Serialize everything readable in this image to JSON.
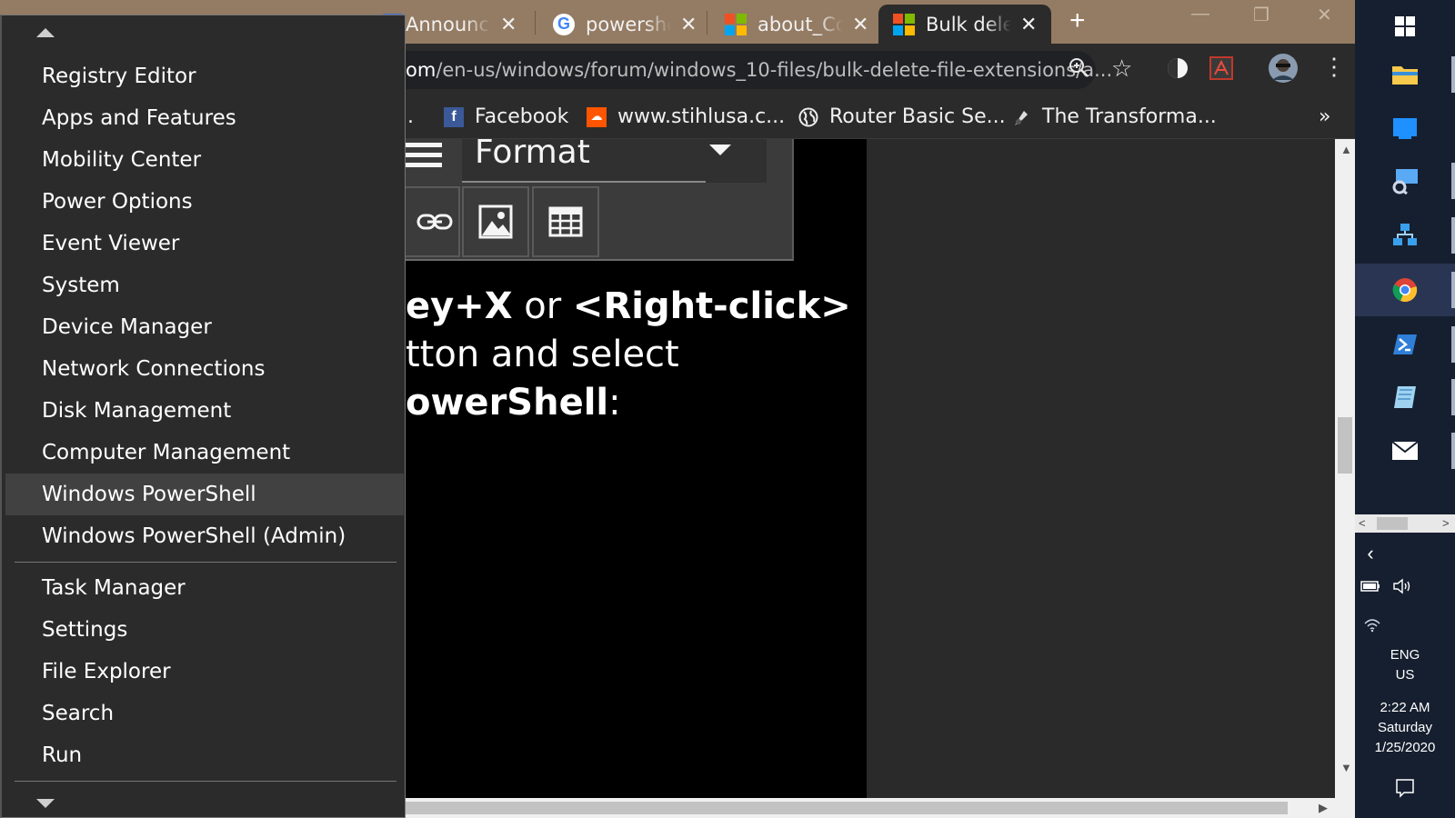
{
  "browser": {
    "tabs": [
      {
        "title": "Announc",
        "close": "✕",
        "icon": "announcement-icon"
      },
      {
        "title": "powershe",
        "close": "✕",
        "icon": "google-icon"
      },
      {
        "title": "about_Co",
        "close": "✕",
        "icon": "microsoft-icon"
      },
      {
        "title": "Bulk dele",
        "close": "✕",
        "icon": "microsoft-icon",
        "active": true
      }
    ],
    "new_tab": "+",
    "address": {
      "prefix": "om",
      "path": "/en-us/windows/forum/windows_10-files/bulk-delete-file-extensions/a..."
    },
    "bookmarks_bar": [
      {
        "label": "Facebook",
        "icon": "facebook-icon"
      },
      {
        "label": "www.stihlusa.c...",
        "icon": "soundcloud-icon"
      },
      {
        "label": "Router Basic Se...",
        "icon": "globe-icon"
      },
      {
        "label": "The Transforma...",
        "icon": "bookmark-icon"
      }
    ],
    "bookmarks_overflow": "»",
    "bookmarks_truncated": "."
  },
  "editor": {
    "format_label": "Format"
  },
  "article": {
    "line1_a": "ey+X",
    "line1_b": " or ",
    "line1_c": "<Right-click>",
    "line2": "tton and select",
    "line3_a": "owerShell",
    "line3_b": ":"
  },
  "winx_menu": {
    "groups": [
      [
        "Registry Editor",
        "Apps and Features",
        "Mobility Center",
        "Power Options",
        "Event Viewer",
        "System",
        "Device Manager",
        "Network Connections",
        "Disk Management",
        "Computer Management",
        "Windows PowerShell",
        "Windows PowerShell (Admin)"
      ],
      [
        "Task Manager",
        "Settings",
        "File Explorer",
        "Search",
        "Run"
      ]
    ],
    "highlighted": "Windows PowerShell"
  },
  "taskbar": {
    "language": "ENG",
    "region": "US",
    "time": "2:22 AM",
    "day": "Saturday",
    "date": "1/25/2020"
  },
  "colors": {
    "tabstrip": "#947b63",
    "menu_bg": "#2b2b2b",
    "menu_highlight": "#414141",
    "taskbar": "#161f2f"
  }
}
